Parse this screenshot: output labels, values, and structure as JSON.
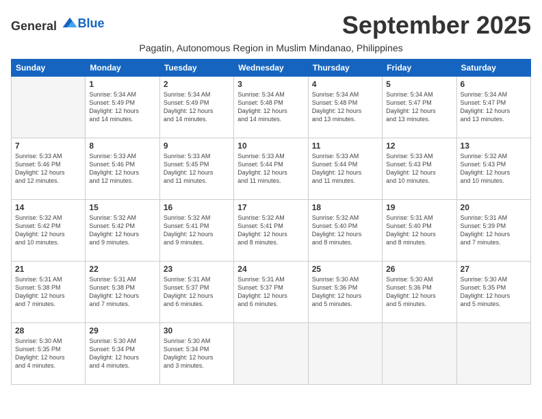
{
  "header": {
    "logo_general": "General",
    "logo_blue": "Blue",
    "month_title": "September 2025",
    "subtitle": "Pagatin, Autonomous Region in Muslim Mindanao, Philippines"
  },
  "columns": [
    "Sunday",
    "Monday",
    "Tuesday",
    "Wednesday",
    "Thursday",
    "Friday",
    "Saturday"
  ],
  "weeks": [
    [
      {
        "day": "",
        "info": ""
      },
      {
        "day": "1",
        "info": "Sunrise: 5:34 AM\nSunset: 5:49 PM\nDaylight: 12 hours\nand 14 minutes."
      },
      {
        "day": "2",
        "info": "Sunrise: 5:34 AM\nSunset: 5:49 PM\nDaylight: 12 hours\nand 14 minutes."
      },
      {
        "day": "3",
        "info": "Sunrise: 5:34 AM\nSunset: 5:48 PM\nDaylight: 12 hours\nand 14 minutes."
      },
      {
        "day": "4",
        "info": "Sunrise: 5:34 AM\nSunset: 5:48 PM\nDaylight: 12 hours\nand 13 minutes."
      },
      {
        "day": "5",
        "info": "Sunrise: 5:34 AM\nSunset: 5:47 PM\nDaylight: 12 hours\nand 13 minutes."
      },
      {
        "day": "6",
        "info": "Sunrise: 5:34 AM\nSunset: 5:47 PM\nDaylight: 12 hours\nand 13 minutes."
      }
    ],
    [
      {
        "day": "7",
        "info": "Sunrise: 5:33 AM\nSunset: 5:46 PM\nDaylight: 12 hours\nand 12 minutes."
      },
      {
        "day": "8",
        "info": "Sunrise: 5:33 AM\nSunset: 5:46 PM\nDaylight: 12 hours\nand 12 minutes."
      },
      {
        "day": "9",
        "info": "Sunrise: 5:33 AM\nSunset: 5:45 PM\nDaylight: 12 hours\nand 11 minutes."
      },
      {
        "day": "10",
        "info": "Sunrise: 5:33 AM\nSunset: 5:44 PM\nDaylight: 12 hours\nand 11 minutes."
      },
      {
        "day": "11",
        "info": "Sunrise: 5:33 AM\nSunset: 5:44 PM\nDaylight: 12 hours\nand 11 minutes."
      },
      {
        "day": "12",
        "info": "Sunrise: 5:33 AM\nSunset: 5:43 PM\nDaylight: 12 hours\nand 10 minutes."
      },
      {
        "day": "13",
        "info": "Sunrise: 5:32 AM\nSunset: 5:43 PM\nDaylight: 12 hours\nand 10 minutes."
      }
    ],
    [
      {
        "day": "14",
        "info": "Sunrise: 5:32 AM\nSunset: 5:42 PM\nDaylight: 12 hours\nand 10 minutes."
      },
      {
        "day": "15",
        "info": "Sunrise: 5:32 AM\nSunset: 5:42 PM\nDaylight: 12 hours\nand 9 minutes."
      },
      {
        "day": "16",
        "info": "Sunrise: 5:32 AM\nSunset: 5:41 PM\nDaylight: 12 hours\nand 9 minutes."
      },
      {
        "day": "17",
        "info": "Sunrise: 5:32 AM\nSunset: 5:41 PM\nDaylight: 12 hours\nand 8 minutes."
      },
      {
        "day": "18",
        "info": "Sunrise: 5:32 AM\nSunset: 5:40 PM\nDaylight: 12 hours\nand 8 minutes."
      },
      {
        "day": "19",
        "info": "Sunrise: 5:31 AM\nSunset: 5:40 PM\nDaylight: 12 hours\nand 8 minutes."
      },
      {
        "day": "20",
        "info": "Sunrise: 5:31 AM\nSunset: 5:39 PM\nDaylight: 12 hours\nand 7 minutes."
      }
    ],
    [
      {
        "day": "21",
        "info": "Sunrise: 5:31 AM\nSunset: 5:38 PM\nDaylight: 12 hours\nand 7 minutes."
      },
      {
        "day": "22",
        "info": "Sunrise: 5:31 AM\nSunset: 5:38 PM\nDaylight: 12 hours\nand 7 minutes."
      },
      {
        "day": "23",
        "info": "Sunrise: 5:31 AM\nSunset: 5:37 PM\nDaylight: 12 hours\nand 6 minutes."
      },
      {
        "day": "24",
        "info": "Sunrise: 5:31 AM\nSunset: 5:37 PM\nDaylight: 12 hours\nand 6 minutes."
      },
      {
        "day": "25",
        "info": "Sunrise: 5:30 AM\nSunset: 5:36 PM\nDaylight: 12 hours\nand 5 minutes."
      },
      {
        "day": "26",
        "info": "Sunrise: 5:30 AM\nSunset: 5:36 PM\nDaylight: 12 hours\nand 5 minutes."
      },
      {
        "day": "27",
        "info": "Sunrise: 5:30 AM\nSunset: 5:35 PM\nDaylight: 12 hours\nand 5 minutes."
      }
    ],
    [
      {
        "day": "28",
        "info": "Sunrise: 5:30 AM\nSunset: 5:35 PM\nDaylight: 12 hours\nand 4 minutes."
      },
      {
        "day": "29",
        "info": "Sunrise: 5:30 AM\nSunset: 5:34 PM\nDaylight: 12 hours\nand 4 minutes."
      },
      {
        "day": "30",
        "info": "Sunrise: 5:30 AM\nSunset: 5:34 PM\nDaylight: 12 hours\nand 3 minutes."
      },
      {
        "day": "",
        "info": ""
      },
      {
        "day": "",
        "info": ""
      },
      {
        "day": "",
        "info": ""
      },
      {
        "day": "",
        "info": ""
      }
    ]
  ]
}
